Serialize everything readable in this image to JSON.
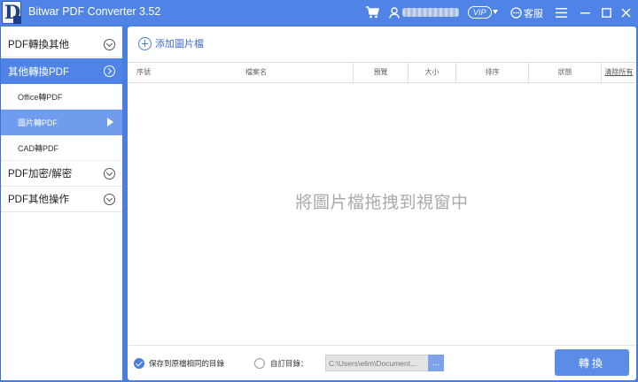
{
  "app": {
    "title": "Bitwar PDF Converter 3.52",
    "logo_letter": "D"
  },
  "titlebar": {
    "vip_label": "VIP",
    "service_label": "客服"
  },
  "sidebar": {
    "categories": [
      {
        "label": "PDF轉換其他"
      },
      {
        "label": "其他轉換PDF",
        "subitems": [
          "Office轉PDF",
          "圖片轉PDF",
          "CAD轉PDF"
        ]
      },
      {
        "label": "PDF加密/解密"
      },
      {
        "label": "PDF其他操作"
      }
    ],
    "active_category": "其他轉換PDF",
    "active_subitem": "圖片轉PDF"
  },
  "main": {
    "add_label": "添加圖片檔",
    "columns": [
      "序號",
      "檔案名",
      "預覽",
      "大小",
      "排序",
      "狀態"
    ],
    "clear_label": "清除所有",
    "drop_hint": "將圖片檔拖拽到視窗中"
  },
  "footer": {
    "save_same_label": "保存到原檔相同的目錄",
    "custom_label": "自訂目錄：",
    "path_value": "C:\\Users\\elim\\Document...",
    "browse_label": "...",
    "convert_label": "轉換"
  },
  "colors": {
    "accent": "#4f84e6",
    "submenu_active": "#6f9cec",
    "button": "#5b8ce8"
  }
}
